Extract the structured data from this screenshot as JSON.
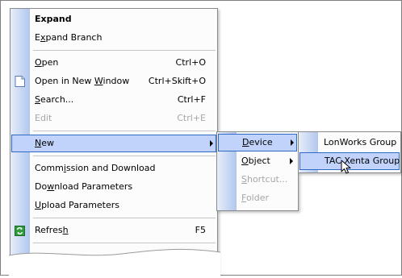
{
  "main_menu": {
    "items": [
      {
        "label": "Expand",
        "bold": true
      },
      {
        "pre": "E",
        "u": "x",
        "post": "pand Branch"
      },
      {
        "pre": "",
        "u": "O",
        "post": "pen",
        "shortcut": "Ctrl+O"
      },
      {
        "pre": "Open in New ",
        "u": "W",
        "post": "indow",
        "shortcut": "Ctrl+Skift+O"
      },
      {
        "pre": "",
        "u": "S",
        "post": "earch...",
        "shortcut": "Ctrl+F"
      },
      {
        "pre": "",
        "u": "E",
        "post": "dit",
        "shortcut": "Ctrl+E"
      },
      {
        "pre": "",
        "u": "N",
        "post": "ew"
      },
      {
        "pre": "Comm",
        "u": "i",
        "post": "ssion and Download"
      },
      {
        "pre": "Do",
        "u": "w",
        "post": "nload Parameters"
      },
      {
        "pre": "",
        "u": "U",
        "post": "pload Parameters"
      },
      {
        "pre": "Refres",
        "u": "h",
        "post": "",
        "shortcut": "F5"
      }
    ]
  },
  "new_submenu": {
    "items": [
      {
        "pre": "",
        "u": "D",
        "post": "evice"
      },
      {
        "pre": "",
        "u": "O",
        "post": "bject"
      },
      {
        "pre": "",
        "u": "S",
        "post": "hortcut..."
      },
      {
        "pre": "",
        "u": "F",
        "post": "older"
      }
    ]
  },
  "device_submenu": {
    "items": [
      {
        "label": "LonWorks Group"
      },
      {
        "label": "TAC Xenta Group"
      }
    ]
  },
  "colors": {
    "highlight_bg": "#c1d3fb",
    "highlight_border": "#316ac5",
    "gutter": "#c9d8f3",
    "disabled_text": "#a6a6a6"
  }
}
